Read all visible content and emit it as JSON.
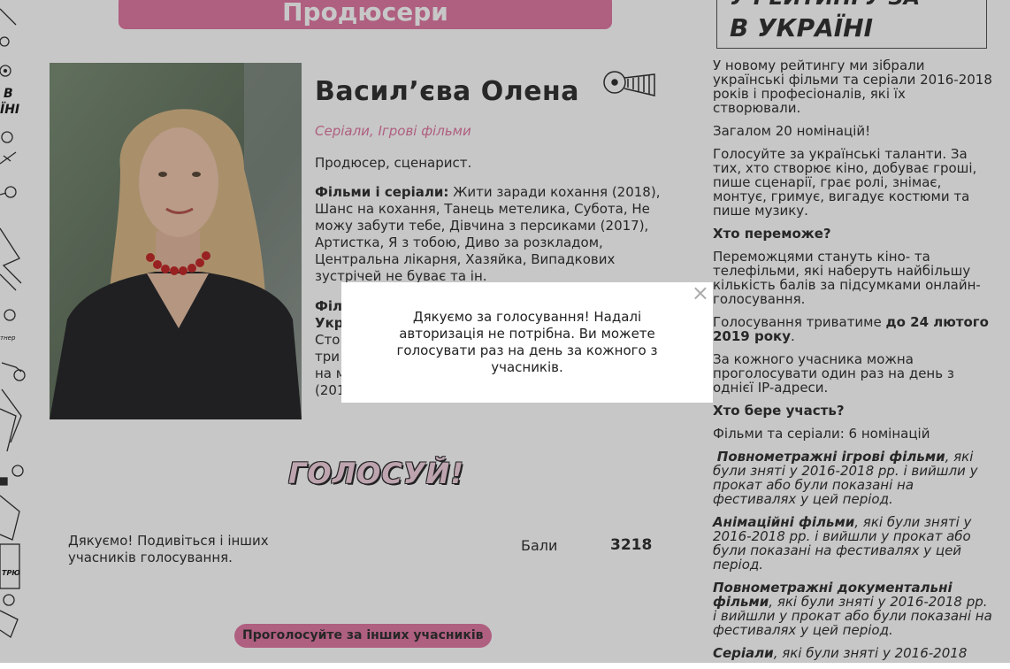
{
  "section_title": "Продюсери",
  "person": {
    "name": "Васил’єва Олена",
    "categories": "Серіали, Ігрові фільми",
    "role": "Продюсер, сценарист.",
    "films_label": "Фільми і серіали:",
    "films_text": "Жити заради кохання (2018), Шанс на кохання, Танець метелика, Субота, Не можу забути тебе, Дівчина з персиками (2017), Артистка, Я з тобою, Диво за розкладом, Центральна лікарня, Хазяйка, Випадкових зустрічей не буває та ін.",
    "more_line1": "Філ",
    "more_line2": "Укр",
    "more_line3": "Сто",
    "more_line4": "три",
    "more_line5": "на м",
    "more_line6": "(201"
  },
  "vote_title": "ГОЛОСУЙ!",
  "thanks_text": "Дякуємо! Подивіться і інших учасників голосування.",
  "score": {
    "label": "Бали",
    "value": "3218"
  },
  "vote_others_button": "Проголосуйте за інших учасників",
  "sidebar": {
    "box_top": "У РЕЙТИНГУ ЗА",
    "box_title": "В УКРАЇНІ",
    "intro": "У новому рейтингу ми зібрали українські фільми та серіали 2016-2018 років і професіоналів, які їх створювали.",
    "total": "Загалом 20 номінацій!",
    "call": "Голосуйте за українські таланти. За тих, хто створює кіно, добуває гроші, пише сценарії, грає ролі, знімає, монтує, гримує, вигадує костюми та пише музику.",
    "who_wins_head": "Хто переможе?",
    "who_wins_text": "Переможцями стануть кіно- та телефільми, які наберуть найбільшу кількість балів за підсумками онлайн-голосування.",
    "deadline_pre": "Голосування триватиме ",
    "deadline_bold": "до 24 лютого 2019 року",
    "deadline_post": ".",
    "once_per_day": "За кожного учасника можна проголосувати один раз на день з однієї IP-адреси.",
    "who_participates_head": "Хто бере участь?",
    "films_series": "Фільми та серіали: 6 номінацій",
    "cat1_bold": "Повнометражні ігрові фільми",
    "cat1_text": ", які були зняті у 2016-2018 рр. і вийшли у прокат або були показані на фестивалях у цей період.",
    "cat2_bold": "Анімаційні фільми",
    "cat2_text": ", які були зняті у 2016-2018 рр. і вийшли у прокат або були показані на фестивалях у цей період.",
    "cat3_bold": "Повнометражні документальні фільми",
    "cat3_text": ", які були зняті у 2016-2018 рр. і вийшли у прокат або були показані на фестивалях у цей період.",
    "cat4_bold": "Серіали",
    "cat4_text": ", які були зняті у 2016-2018"
  },
  "doodles": {
    "text1": "В",
    "text2": "ЇНІ",
    "text3": "тнер",
    "text4": "ТРЮ"
  },
  "modal": {
    "close": "×",
    "message": "Дякуємо за голосування! Надалі авторизація не потрібна. Ви можете голосувати раз на день за кожного з учасників."
  },
  "colors": {
    "accent": "#e07aa4",
    "text": "#333333",
    "overlay": "rgba(0,0,0,0.22)"
  }
}
